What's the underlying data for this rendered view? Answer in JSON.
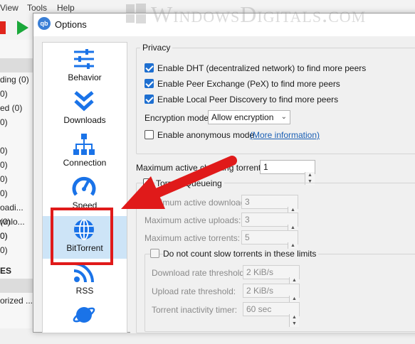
{
  "watermark": {
    "text": "WindowsDigitals.com"
  },
  "background": {
    "menu": [
      "View",
      "Tools",
      "Help"
    ],
    "sidebar_items": [
      "ding (0)",
      "0)",
      "ed (0)",
      "0)",
      "0)",
      "0)",
      "0)",
      "0)",
      "oadi...",
      "wnlo...",
      "0)",
      "(0)",
      "0)",
      "0)"
    ],
    "headers": [
      "ES",
      ""
    ],
    "bottom_item": "orized ..."
  },
  "dialog": {
    "title": "Options",
    "app_icon": "qb",
    "nav": [
      {
        "label": "Behavior",
        "icon": "sliders-icon"
      },
      {
        "label": "Downloads",
        "icon": "chevron-down-icon"
      },
      {
        "label": "Connection",
        "icon": "network-icon"
      },
      {
        "label": "Speed",
        "icon": "gauge-icon"
      },
      {
        "label": "BitTorrent",
        "icon": "globe-icon"
      },
      {
        "label": "RSS",
        "icon": "rss-icon"
      },
      {
        "label": "",
        "icon": "planet-icon"
      }
    ],
    "privacy": {
      "title": "Privacy",
      "dht": "Enable DHT (decentralized network) to find more peers",
      "pex": "Enable Peer Exchange (PeX) to find more peers",
      "lpd": "Enable Local Peer Discovery to find more peers",
      "encryption_label": "Encryption mode:",
      "encryption_value": "Allow encryption",
      "anonymous": "Enable anonymous mode",
      "more_info": "(More information)"
    },
    "checking": {
      "label": "Maximum active checking torrents:",
      "value": "1"
    },
    "queueing": {
      "title": "Torrent Queueing",
      "max_downloads_label": "Maximum active downloads:",
      "max_downloads": "3",
      "max_uploads_label": "Maximum active uploads:",
      "max_uploads": "3",
      "max_torrents_label": "Maximum active torrents:",
      "max_torrents": "5",
      "slow_label": "Do not count slow torrents in these limits",
      "dl_threshold_label": "Download rate threshold:",
      "dl_threshold": "2 KiB/s",
      "ul_threshold_label": "Upload rate threshold:",
      "ul_threshold": "2 KiB/s",
      "inactivity_label": "Torrent inactivity timer:",
      "inactivity": "60 sec"
    }
  },
  "colors": {
    "accent": "#1e6fd0",
    "highlight": "#e01a1a",
    "nav_selected": "#cde4f7",
    "icon_blue": "#1a73e8"
  }
}
